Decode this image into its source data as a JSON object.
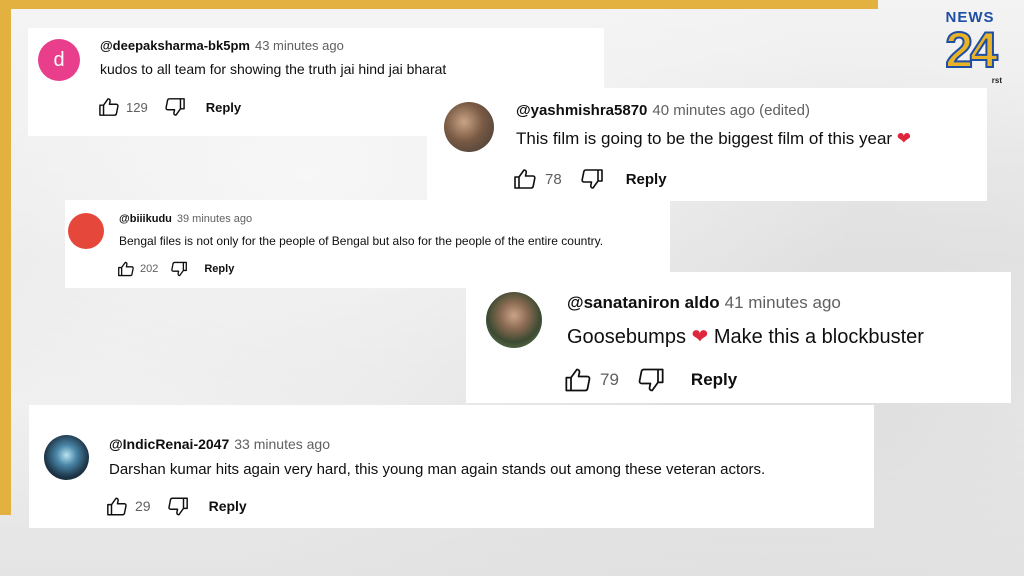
{
  "brand": {
    "logo_top": "NEWS",
    "logo_num": "24",
    "logo_tag": "rst"
  },
  "colors": {
    "frame": "#e2b13f",
    "heart": "#e0263c",
    "avatar_d": "#e83e8c",
    "avatar_red": "#e5483b"
  },
  "comments": [
    {
      "handle": "@deepaksharma-bk5pm",
      "time": "43 minutes ago",
      "text": "kudos to all team for showing the truth jai hind jai bharat",
      "likes": "129",
      "reply": "Reply",
      "avatar_letter": "d"
    },
    {
      "handle": "@yashmishra5870",
      "time": "40 minutes ago (edited)",
      "text": "This film is going to be the biggest film of this year",
      "emoji": "❤",
      "likes": "78",
      "reply": "Reply"
    },
    {
      "handle": "@biiikudu",
      "time": "39 minutes ago",
      "text": "Bengal files is not only for the people of Bengal but also for the people of the entire country.",
      "likes": "202",
      "reply": "Reply"
    },
    {
      "handle": "@sanataniron aldo",
      "time": "41 minutes ago",
      "text_a": "Goosebumps",
      "emoji": "❤",
      "text_b": "Make this a blockbuster",
      "likes": "79",
      "reply": "Reply"
    },
    {
      "handle": "@IndicRenai-2047",
      "time": "33 minutes ago",
      "text": "Darshan kumar hits again very hard, this young man again stands out among these veteran actors.",
      "likes": "29",
      "reply": "Reply"
    }
  ]
}
